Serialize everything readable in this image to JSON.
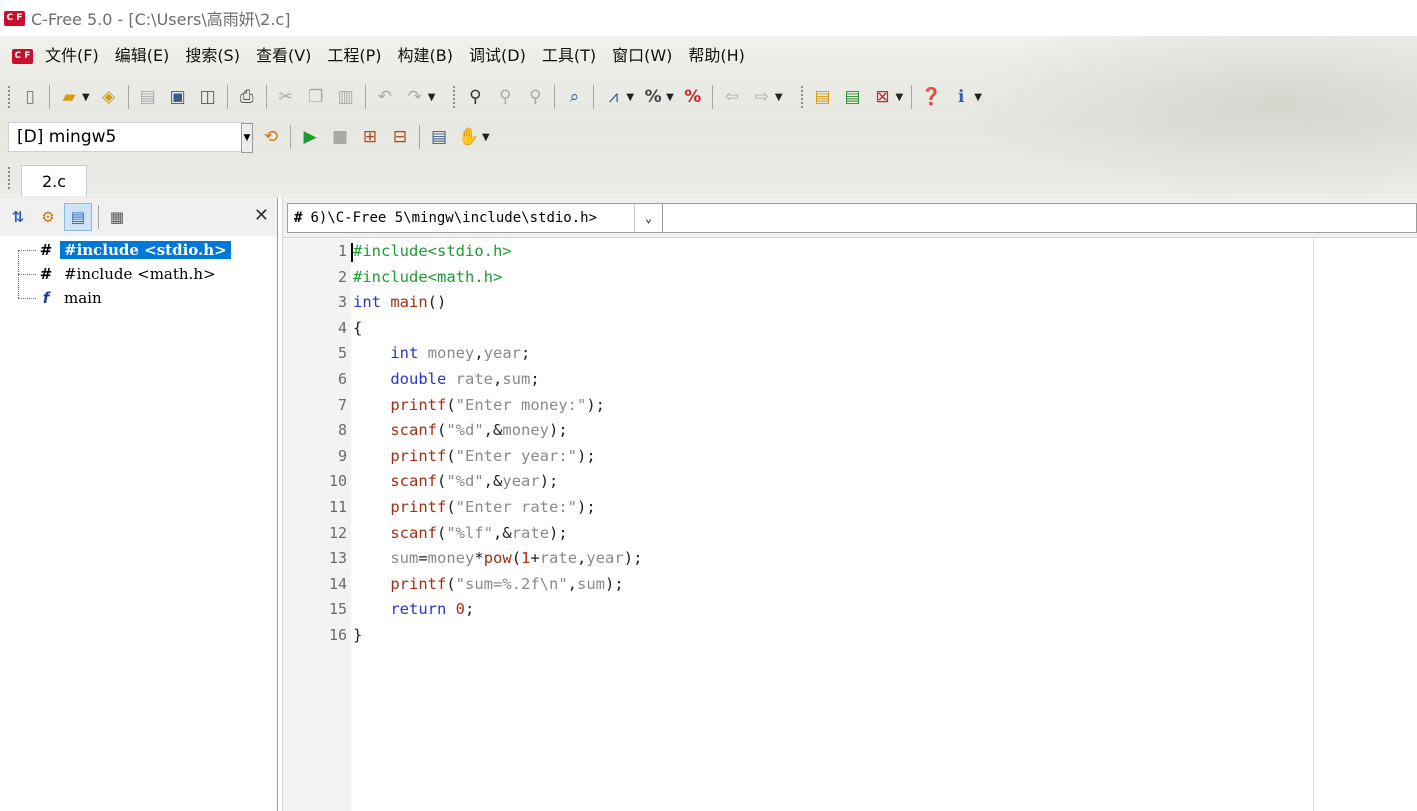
{
  "window": {
    "title": "C-Free 5.0 - [C:\\Users\\高雨妍\\2.c]",
    "logo_text": "C F"
  },
  "menu": [
    "文件(F)",
    "编辑(E)",
    "搜索(S)",
    "查看(V)",
    "工程(P)",
    "构建(B)",
    "调试(D)",
    "工具(T)",
    "窗口(W)",
    "帮助(H)"
  ],
  "compiler": {
    "selected": "[D] mingw5"
  },
  "tabs": [
    {
      "label": "2.c"
    }
  ],
  "symbol_tree": [
    {
      "icon": "#",
      "label": "#include <stdio.h>",
      "selected": true
    },
    {
      "icon": "#",
      "label": "#include <math.h>",
      "selected": false
    },
    {
      "icon": "f",
      "label": "main",
      "selected": false
    }
  ],
  "include_combo": {
    "hash": "#",
    "value": "6)\\C-Free 5\\mingw\\include\\stdio.h>"
  },
  "editor": {
    "line_numbers": [
      "1",
      "2",
      "3",
      "4",
      "5",
      "6",
      "7",
      "8",
      "9",
      "10",
      "11",
      "12",
      "13",
      "14",
      "15",
      "16"
    ],
    "code_lines": [
      "#include<stdio.h>",
      "#include<math.h>",
      "int main()",
      "{",
      "    int money,year;",
      "    double rate,sum;",
      "    printf(\"Enter money:\");",
      "    scanf(\"%d\",&money);",
      "    printf(\"Enter year:\");",
      "    scanf(\"%d\",&year);",
      "    printf(\"Enter rate:\");",
      "    scanf(\"%lf\",&rate);",
      "    sum=money*pow(1+rate,year);",
      "    printf(\"sum=%.2f\\n\",sum);",
      "    return 0;",
      "}"
    ]
  },
  "colors": {
    "preprocessor": "#1f9b2f",
    "keyword": "#2637c4",
    "function": "#a32e12",
    "string": "#8a8a8a",
    "selection": "#0078d7"
  }
}
